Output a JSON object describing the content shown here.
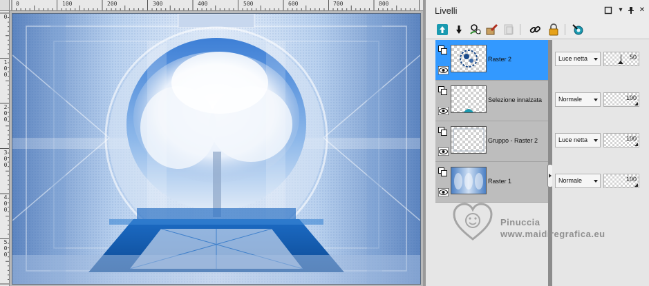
{
  "ruler": {
    "top_labels": [
      "0",
      "100",
      "200",
      "300",
      "400",
      "500",
      "600",
      "700",
      "800"
    ],
    "left_labels": [
      "0",
      "1\n0\n0",
      "2\n0\n0",
      "3\n0\n0",
      "4\n0\n0",
      "5\n0\n0"
    ]
  },
  "panel": {
    "title": "Livelli",
    "header_buttons": {
      "maximize_icon": "square-icon",
      "menu_icon": "chevron-down-icon",
      "pin_icon": "pin-icon",
      "close_icon": "close-icon",
      "close_label": "✕",
      "menu_label": "▾"
    },
    "toolbar": [
      {
        "icon": "new-raster-layer-icon"
      },
      {
        "icon": "new-vector-layer-icon"
      },
      {
        "icon": "layer-visibility-icon"
      },
      {
        "icon": "brush-mask-icon"
      },
      {
        "icon": "duplicate-layer-icon"
      },
      {
        "icon": "link-icon"
      },
      {
        "icon": "lock-icon"
      },
      {
        "icon": "properties-icon"
      }
    ],
    "layers": [
      {
        "name": "Raster 2",
        "blend_mode": "Luce netta",
        "opacity": "50",
        "selected": true,
        "thumb": "logo"
      },
      {
        "name": "Selezione innalzata",
        "blend_mode": "Normale",
        "opacity": "100",
        "selected": false,
        "thumb": "selection"
      },
      {
        "name": "Gruppo - Raster 2",
        "blend_mode": "Luce netta",
        "opacity": "100",
        "selected": false,
        "thumb": "group"
      },
      {
        "name": "Raster 1",
        "blend_mode": "Normale",
        "opacity": "100",
        "selected": false,
        "thumb": "blue"
      }
    ]
  },
  "watermark": {
    "line1": "Pinuccia",
    "line2": "www.maidiregrafica.eu"
  },
  "colors": {
    "selected_row": "#3399ff",
    "canvas_blue": "#2f6fc0",
    "accent_teal": "#1a9ab0"
  }
}
